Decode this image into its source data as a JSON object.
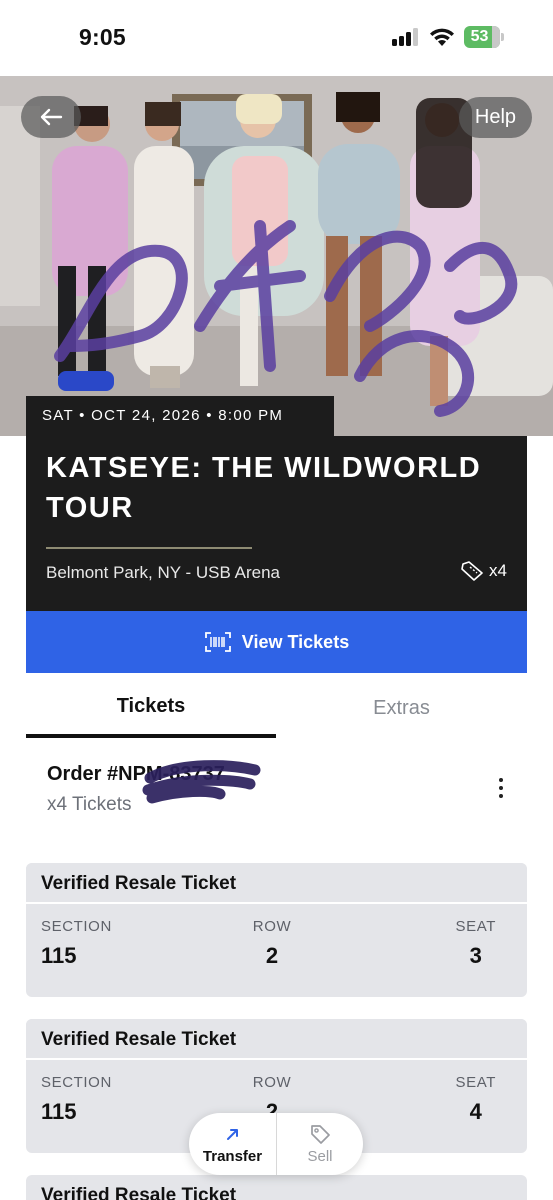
{
  "status_bar": {
    "time": "9:05",
    "battery": "53"
  },
  "header": {
    "help_label": "Help"
  },
  "event": {
    "date_line": "SAT • OCT 24, 2026 • 8:00 PM",
    "title": "KATSEYE: THE WILDWORLD TOUR",
    "venue": "Belmont Park, NY - USB Arena",
    "ticket_count": "x4"
  },
  "view_tickets_label": "View Tickets",
  "tabs": [
    {
      "label": "Tickets",
      "selected": true
    },
    {
      "label": "Extras",
      "selected": false
    }
  ],
  "order": {
    "number": "Order #NPM-83737",
    "count": "x4 Tickets"
  },
  "tickets": [
    {
      "title": "Verified Resale Ticket",
      "section_label": "SECTION",
      "row_label": "ROW",
      "seat_label": "SEAT",
      "section": "115",
      "row": "2",
      "seat": "3"
    },
    {
      "title": "Verified Resale Ticket",
      "section_label": "SECTION",
      "row_label": "ROW",
      "seat_label": "SEAT",
      "section": "115",
      "row": "2",
      "seat": "4"
    },
    {
      "title": "Verified Resale Ticket"
    }
  ],
  "actions": {
    "transfer_label": "Transfer",
    "sell_label": "Sell"
  },
  "colors": {
    "primary_blue": "#2F63E6",
    "card_dark": "#1C1C1C",
    "ticket_card_bg": "#E4E5E9",
    "battery_green": "#5DBB63"
  },
  "icons": [
    "back-arrow-icon",
    "ticket-icon",
    "barcode-icon",
    "more-vertical-icon",
    "transfer-arrow-icon",
    "tag-icon"
  ]
}
